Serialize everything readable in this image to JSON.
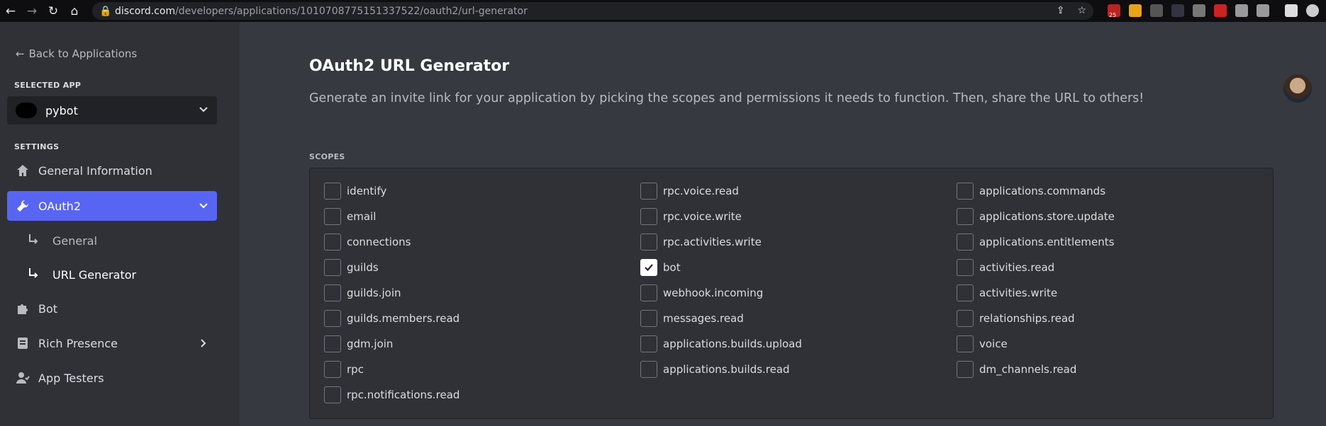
{
  "browser": {
    "url_host": "discord.com",
    "url_path": "/developers/applications/1010708775151337522/oauth2/url-generator",
    "badge_count": "25"
  },
  "sidebar": {
    "back_label": "Back to Applications",
    "selected_app_heading": "SELECTED APP",
    "selected_app_name": "pybot",
    "settings_heading": "SETTINGS",
    "items": [
      {
        "label": "General Information"
      },
      {
        "label": "OAuth2"
      },
      {
        "label": "General"
      },
      {
        "label": "URL Generator"
      },
      {
        "label": "Bot"
      },
      {
        "label": "Rich Presence"
      },
      {
        "label": "App Testers"
      }
    ]
  },
  "main": {
    "title": "OAuth2 URL Generator",
    "description": "Generate an invite link for your application by picking the scopes and permissions it needs to function. Then, share the URL to others!",
    "scopes_heading": "SCOPES",
    "scopes_col1": [
      "identify",
      "email",
      "connections",
      "guilds",
      "guilds.join",
      "guilds.members.read",
      "gdm.join",
      "rpc",
      "rpc.notifications.read"
    ],
    "scopes_col2": [
      "rpc.voice.read",
      "rpc.voice.write",
      "rpc.activities.write",
      "bot",
      "webhook.incoming",
      "messages.read",
      "applications.builds.upload",
      "applications.builds.read"
    ],
    "scopes_col3": [
      "applications.commands",
      "applications.store.update",
      "applications.entitlements",
      "activities.read",
      "activities.write",
      "relationships.read",
      "voice",
      "dm_channels.read"
    ],
    "checked_scope": "bot"
  },
  "colors": {
    "accent": "#5865f2",
    "background": "#36393f",
    "sidebar": "#2f3136"
  }
}
